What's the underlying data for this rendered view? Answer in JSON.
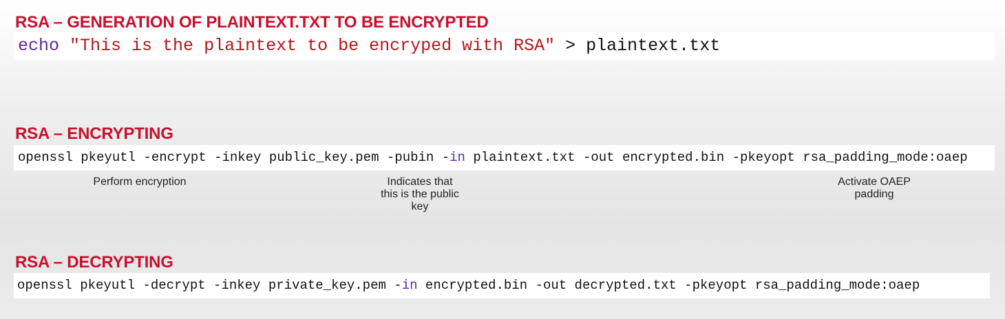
{
  "sections": [
    {
      "heading": "RSA – GENERATION OF PLAINTEXT.TXT TO BE ENCRYPTED",
      "code": {
        "keyword": "echo",
        "string": "\"This is the plaintext to be encryped with RSA\"",
        "rest": " > plaintext.txt"
      }
    },
    {
      "heading": "RSA – ENCRYPTING",
      "code": {
        "before": "openssl pkeyutl -encrypt -inkey public_key.pem -pubin -",
        "keyword": "in",
        "after": " plaintext.txt -out encrypted.bin -pkeyopt rsa_padding_mode:oaep"
      },
      "annotations": [
        "Perform encryption",
        "Indicates that\nthis is the public\nkey",
        "Activate OAEP\npadding"
      ]
    },
    {
      "heading": "RSA – DECRYPTING",
      "code": {
        "before": "openssl pkeyutl -decrypt -inkey private_key.pem -",
        "keyword": "in",
        "after": " encrypted.bin -out decrypted.txt -pkeyopt rsa_padding_mode:oaep"
      }
    }
  ],
  "colors": {
    "heading": "#c8102e",
    "keyword": "#5b2a9a",
    "string": "#b5161c"
  }
}
